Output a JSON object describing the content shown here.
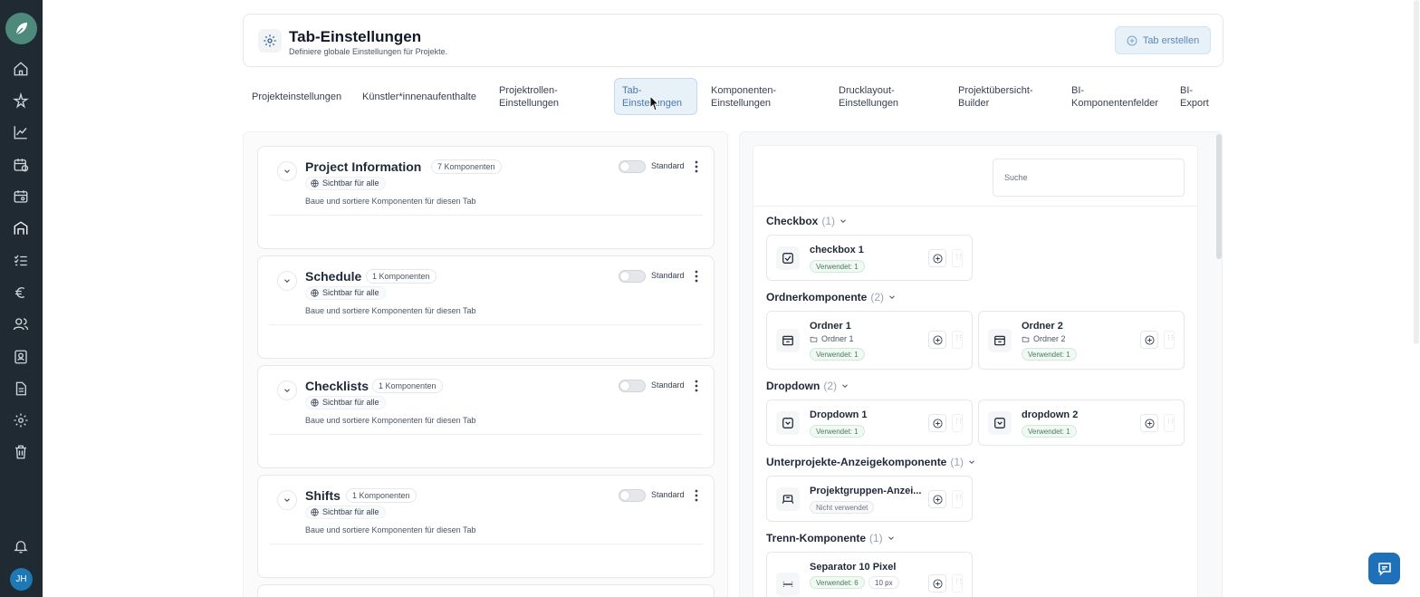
{
  "header": {
    "title": "Tab-Einstellungen",
    "subtitle": "Definiere globale Einstellungen für Projekte.",
    "create_button": "Tab erstellen"
  },
  "tabs": [
    {
      "label": "Projekteinstellungen"
    },
    {
      "label": "Künstler*innenaufenthalte"
    },
    {
      "label": "Projektrollen-Einstellungen"
    },
    {
      "label": "Tab-Einstellungen",
      "active": true
    },
    {
      "label": "Komponenten-Einstellungen"
    },
    {
      "label": "Drucklayout-Einstellungen"
    },
    {
      "label": "Projektübersicht-Builder"
    },
    {
      "label": "BI-Komponentenfelder"
    },
    {
      "label": "BI-Export"
    }
  ],
  "project_tabs": [
    {
      "name": "Project Information",
      "count": "7 Komponenten",
      "visibility": "Sichtbar für alle",
      "description": "Baue und sortiere Komponenten für diesen Tab",
      "standard": "Standard"
    },
    {
      "name": "Schedule",
      "count": "1 Komponenten",
      "visibility": "Sichtbar für alle",
      "description": "Baue und sortiere Komponenten für diesen Tab",
      "standard": "Standard"
    },
    {
      "name": "Checklists",
      "count": "1 Komponenten",
      "visibility": "Sichtbar für alle",
      "description": "Baue und sortiere Komponenten für diesen Tab",
      "standard": "Standard"
    },
    {
      "name": "Shifts",
      "count": "1 Komponenten",
      "visibility": "Sichtbar für alle",
      "description": "Baue und sortiere Komponenten für diesen Tab",
      "standard": "Standard"
    }
  ],
  "library": {
    "search_placeholder": "Suche",
    "groups": [
      {
        "name": "Checkbox",
        "count": "(1)",
        "items": [
          {
            "name": "checkbox 1",
            "badge": "Verwendet: 1",
            "icon": "checkbox-icon"
          }
        ]
      },
      {
        "name": "Ordnerkomponente",
        "count": "(2)",
        "items": [
          {
            "name": "Ordner 1",
            "folder": "Ordner 1",
            "badge": "Verwendet: 1",
            "icon": "folder-component-icon"
          },
          {
            "name": "Ordner 2",
            "folder": "Ordner 2",
            "badge": "Verwendet: 1",
            "icon": "folder-component-icon"
          }
        ]
      },
      {
        "name": "Dropdown",
        "count": "(2)",
        "items": [
          {
            "name": "Dropdown 1",
            "badge": "Verwendet: 1",
            "icon": "dropdown-icon"
          },
          {
            "name": "dropdown 2",
            "badge": "Verwendet: 1",
            "icon": "dropdown-icon"
          }
        ]
      },
      {
        "name": "Unterprojekte-Anzeigekomponente",
        "count": "(1)",
        "items": [
          {
            "name": "Projektgruppen-Anzei...",
            "badge": "Nicht verwendet",
            "icon": "subproject-icon"
          }
        ]
      },
      {
        "name": "Trenn-Komponente",
        "count": "(1)",
        "items": [
          {
            "name": "Separator 10 Pixel",
            "badge": "Verwendet: 6",
            "badge2": "10 px",
            "icon": "separator-icon"
          }
        ]
      }
    ]
  },
  "user": {
    "initials": "JH"
  },
  "colors": {
    "rail": "#1f2a33",
    "accent": "#1e70b8",
    "active_tab_bg": "#e8f0f8"
  }
}
